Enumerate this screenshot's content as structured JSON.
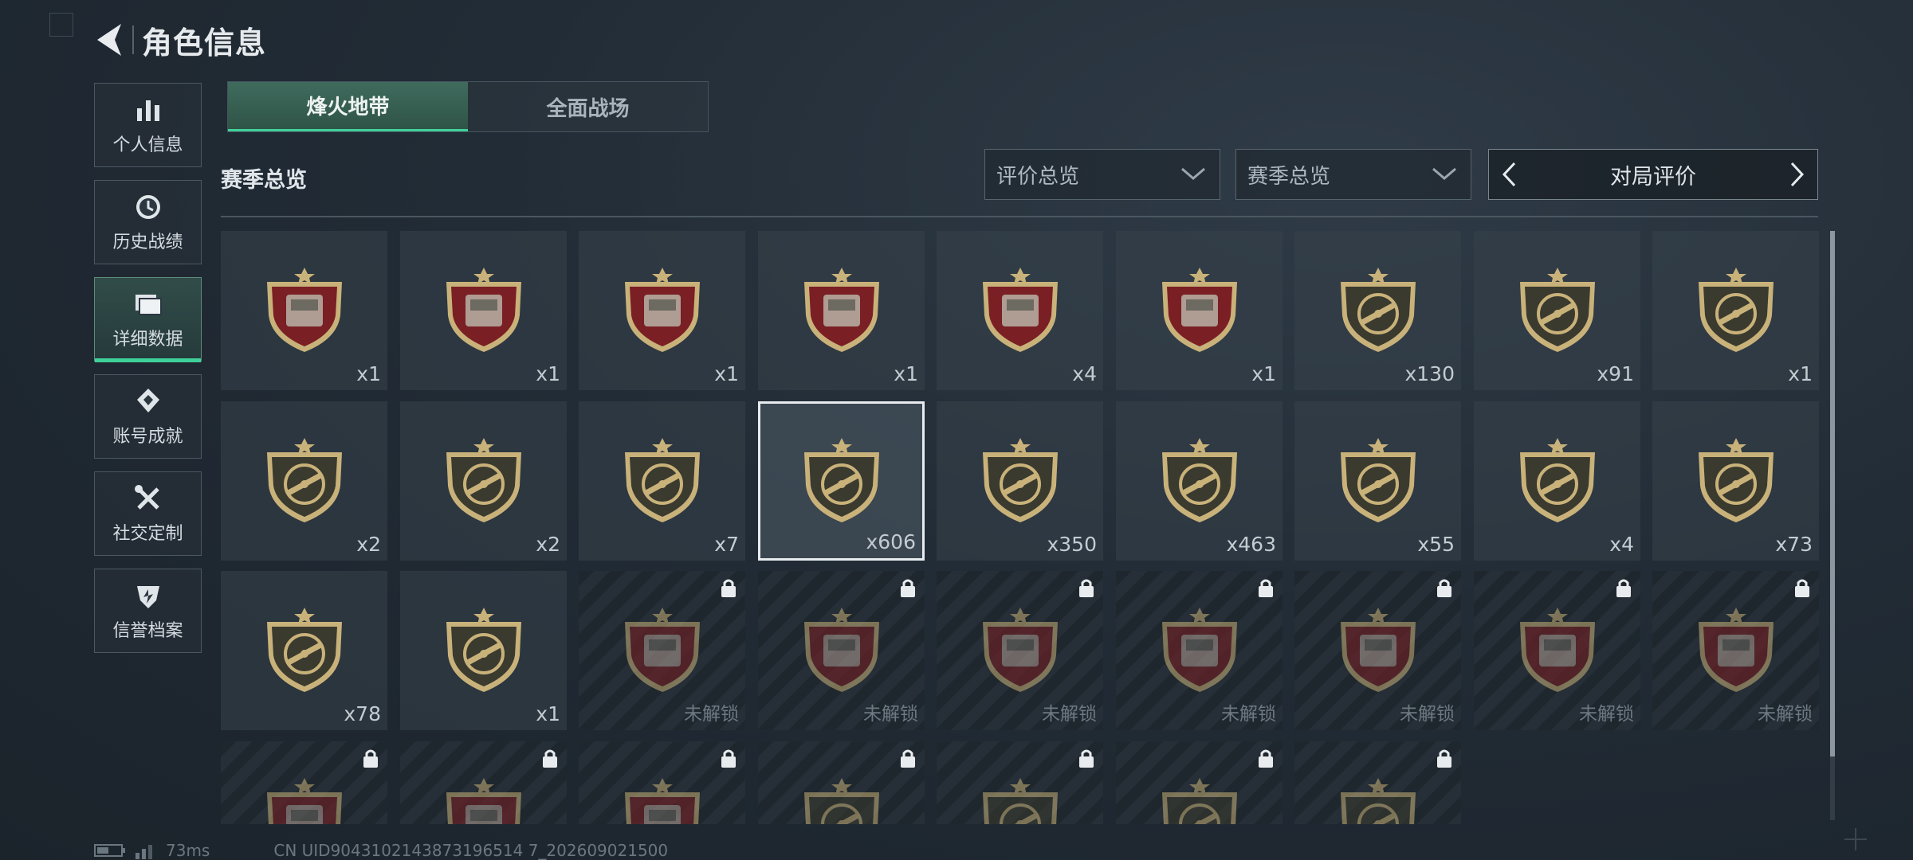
{
  "header": {
    "title": "角色信息"
  },
  "sidebar": {
    "items": [
      {
        "label": "个人信息",
        "icon": "bar-chart-icon"
      },
      {
        "label": "历史战绩",
        "icon": "clock-icon"
      },
      {
        "label": "详细数据",
        "icon": "folder-icon",
        "active": true
      },
      {
        "label": "账号成就",
        "icon": "medal-icon"
      },
      {
        "label": "社交定制",
        "icon": "tools-icon"
      },
      {
        "label": "信誉档案",
        "icon": "shield-icon"
      }
    ]
  },
  "tabs": [
    {
      "label": "烽火地带",
      "active": true
    },
    {
      "label": "全面战场",
      "active": false
    }
  ],
  "section_title": "赛季总览",
  "filters": {
    "rating": "评价总览",
    "season": "赛季总览",
    "pager_label": "对局评价"
  },
  "locked_label": "未解锁",
  "colors": {
    "accent": "#3fd19a",
    "badge_gold": "#c9b27a",
    "badge_red": "#7a1f24"
  },
  "badges": [
    {
      "icon": "tank-badge-icon",
      "style": "red",
      "count": "x1"
    },
    {
      "icon": "tablet-badge-icon",
      "style": "red",
      "count": "x1"
    },
    {
      "icon": "metal-plate-badge-icon",
      "style": "red",
      "count": "x1"
    },
    {
      "icon": "battery-pack-badge-icon",
      "style": "red",
      "count": "x1"
    },
    {
      "icon": "circuit-board-badge-icon",
      "style": "red",
      "count": "x4"
    },
    {
      "icon": "reactor-core-badge-icon",
      "style": "red",
      "count": "x1"
    },
    {
      "icon": "assault-rifle-badge-icon",
      "style": "gold",
      "count": "x130"
    },
    {
      "icon": "rifle-badge-icon",
      "style": "gold",
      "count": "x91"
    },
    {
      "icon": "sniper-badge-icon",
      "style": "gold",
      "count": "x1"
    },
    {
      "icon": "smg-badge-icon",
      "style": "gold",
      "count": "x2"
    },
    {
      "icon": "shotgun-badge-icon",
      "style": "gold",
      "count": "x2"
    },
    {
      "icon": "marksman-badge-icon",
      "style": "gold",
      "count": "x7"
    },
    {
      "icon": "knife-badge-icon",
      "style": "gold",
      "count": "x606",
      "selected": true
    },
    {
      "icon": "explosion-badge-icon",
      "style": "gold",
      "count": "x350"
    },
    {
      "icon": "wreath-badge-icon",
      "style": "gold",
      "count": "x463"
    },
    {
      "icon": "rank-chevron-badge-icon",
      "style": "gold",
      "count": "x55"
    },
    {
      "icon": "operator-beret-badge-icon",
      "style": "gold",
      "count": "x4"
    },
    {
      "icon": "operator-mask-badge-icon",
      "style": "gold",
      "count": "x73"
    },
    {
      "icon": "operator-portrait-badge-icon",
      "style": "gold",
      "count": "x78"
    },
    {
      "icon": "operator-bald-badge-icon",
      "style": "gold",
      "count": "x1"
    },
    {
      "icon": "ore-badge-icon",
      "style": "red",
      "locked": true
    },
    {
      "icon": "orb-badge-icon",
      "style": "red",
      "locked": true
    },
    {
      "icon": "terminal-badge-icon",
      "style": "red",
      "locked": true
    },
    {
      "icon": "coffee-machine-badge-icon",
      "style": "red",
      "locked": true
    },
    {
      "icon": "lantern-badge-icon",
      "style": "red",
      "locked": true
    },
    {
      "icon": "treasure-box-badge-icon",
      "style": "red",
      "locked": true
    },
    {
      "icon": "chessboard-badge-icon",
      "style": "red",
      "locked": true
    },
    {
      "icon": "vehicle-badge-icon",
      "style": "red",
      "locked": true
    },
    {
      "icon": "painting-badge-icon",
      "style": "red",
      "locked": true
    },
    {
      "icon": "crystal-badge-icon",
      "style": "red",
      "locked": true
    },
    {
      "icon": "blade-badge-icon",
      "style": "gold",
      "locked": true
    },
    {
      "icon": "skull-badge-icon",
      "style": "gold",
      "locked": true
    },
    {
      "icon": "target-skull-badge-icon",
      "style": "gold",
      "locked": true
    },
    {
      "icon": "operator-badge-icon",
      "style": "gold",
      "locked": true
    }
  ],
  "status_bar": {
    "ping": "73ms",
    "uid": "CN UID9043102143873196514 7_202609021500"
  }
}
